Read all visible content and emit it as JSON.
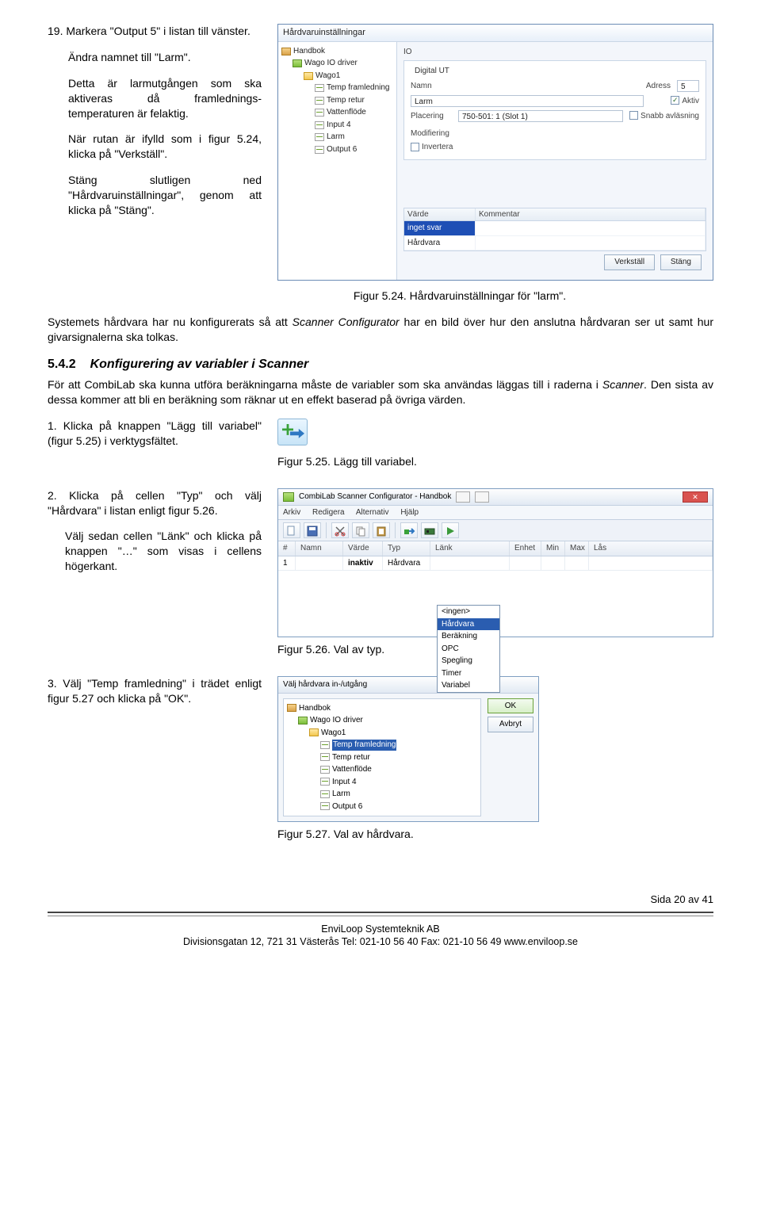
{
  "step19": {
    "num": "19.",
    "p1": "Markera \"Output 5\" i listan till vänster.",
    "p2": "Ändra namnet till \"Larm\".",
    "p3": "Detta är larmutgången som ska aktiveras då framlednings-temperaturen är felaktig.",
    "p4": "När rutan är ifylld som i figur 5.24, klicka på \"Verkställ\".",
    "p5": "Stäng slutligen ned \"Hårdvaruinställningar\", genom att klicka på \"Stäng\"."
  },
  "win524": {
    "title": "Hårdvaruinställningar",
    "tree": {
      "root": "Handbok",
      "drv": "Wago IO driver",
      "dev": "Wago1",
      "ch": [
        "Temp framledning",
        "Temp retur",
        "Vattenflöde",
        "Input 4",
        "Larm",
        "Output 6"
      ]
    },
    "io": "IO",
    "group_digital": "Digital UT",
    "lbl_namn": "Namn",
    "val_namn": "Larm",
    "lbl_adress": "Adress",
    "val_adress": "5",
    "cb_aktiv": "Aktiv",
    "cb_snabb": "Snabb avläsning",
    "lbl_placering": "Placering",
    "val_placering": "750-501: 1 (Slot 1)",
    "lbl_mod": "Modifiering",
    "cb_invertera": "Invertera",
    "col_varde": "Värde",
    "col_comment": "Kommentar",
    "row_inget": "inget svar",
    "row_hw": "Hårdvara",
    "btn_apply": "Verkställ",
    "btn_close": "Stäng"
  },
  "cap524": "Figur 5.24. Hårdvaruinställningar för \"larm\".",
  "para_sys": "Systemets hårdvara har nu konfigurerats så att Scanner Configurator har en bild över hur den anslutna hårdvaran ser ut samt hur givarsignalerna ska tolkas.",
  "heading": {
    "num": "5.4.2",
    "text": "Konfigurering av variabler i Scanner"
  },
  "para_542": "För att CombiLab ska kunna utföra beräkningarna måste de variabler som ska användas läggas till i raderna i Scanner. Den sista av dessa kommer att bli en beräkning som räknar ut en effekt baserad på övriga värden.",
  "step1": {
    "num": "1.",
    "text": "Klicka på knappen \"Lägg till variabel\" (figur 5.25) i verktygsfältet."
  },
  "cap525": "Figur 5.25. Lägg till variabel.",
  "step2": {
    "num": "2.",
    "p1": "Klicka på cellen \"Typ\" och välj \"Hårdvara\" i listan enligt figur 5.26.",
    "p2": "Välj sedan cellen \"Länk\" och klicka på knappen \"…\" som visas i cellens högerkant."
  },
  "app526": {
    "title": "CombiLab Scanner Configurator - Handbok",
    "menu": [
      "Arkiv",
      "Redigera",
      "Alternativ",
      "Hjälp"
    ],
    "cols": [
      "#",
      "Namn",
      "Värde",
      "Typ",
      "Länk",
      "Enhet",
      "Min",
      "Max",
      "Lås"
    ],
    "row1": {
      "num": "1",
      "namn": "",
      "varde": "inaktiv",
      "typ": "Hårdvara"
    },
    "dd": [
      "<ingen>",
      "Hårdvara",
      "Beräkning",
      "OPC",
      "Spegling",
      "Timer",
      "Variabel"
    ]
  },
  "cap526": "Figur 5.26. Val av typ.",
  "step3": {
    "num": "3.",
    "text": "Välj \"Temp framledning\" i trädet enligt figur 5.27 och klicka på \"OK\"."
  },
  "dlg527": {
    "title": "Välj hårdvara in-/utgång",
    "root": "Handbok",
    "drv": "Wago IO driver",
    "dev": "Wago1",
    "items": [
      "Temp framledning",
      "Temp retur",
      "Vattenflöde",
      "Input 4",
      "Larm",
      "Output 6"
    ],
    "ok": "OK",
    "cancel": "Avbryt"
  },
  "cap527": "Figur 5.27. Val av hårdvara.",
  "pagenum": "Sida 20 av 41",
  "footer1": "EnviLoop Systemteknik AB",
  "footer2": "Divisionsgatan 12, 721 31 Västerås Tel: 021-10 56 40 Fax: 021-10 56 49 www.enviloop.se"
}
